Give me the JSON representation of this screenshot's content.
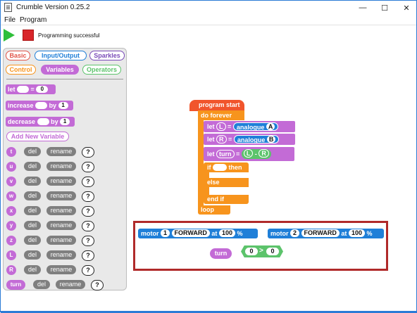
{
  "window": {
    "title": "Crumble Version 0.25.2",
    "minimize": "—",
    "maximize": "☐",
    "close": "✕"
  },
  "menu": {
    "file": "File",
    "program": "Program"
  },
  "toolbar": {
    "status": "Programming successful"
  },
  "palette": {
    "categories": [
      "Basic",
      "Input/Output",
      "Sparkles",
      "Control",
      "Variables",
      "Operators"
    ],
    "blocks": {
      "let": {
        "label": "let",
        "eq": "=",
        "value": "0"
      },
      "increase": {
        "label": "increase",
        "by": "by",
        "value": "1"
      },
      "decrease": {
        "label": "decrease",
        "by": "by",
        "value": "1"
      }
    },
    "add_variable": "Add New Variable",
    "del_label": "del",
    "rename_label": "rename",
    "value_label": "?",
    "variables": [
      "t",
      "u",
      "v",
      "w",
      "x",
      "y",
      "z",
      "L",
      "R",
      "turn"
    ]
  },
  "program": {
    "start": "program start",
    "do_forever": "do forever",
    "let": "let",
    "eq": "=",
    "var_L": "L",
    "var_R": "R",
    "var_turn": "turn",
    "analogue": "analogue",
    "pin_A": "A",
    "pin_B": "B",
    "minus": "-",
    "if": "if",
    "then": "then",
    "else": "else",
    "end_if": "end if",
    "loop": "loop"
  },
  "loose": {
    "motor1": {
      "label": "motor",
      "num": "1",
      "dir": "FORWARD",
      "at": "at",
      "speed": "100",
      "pct": "%"
    },
    "motor2": {
      "label": "motor",
      "num": "2",
      "dir": "FORWARD",
      "at": "at",
      "speed": "100",
      "pct": "%"
    },
    "turn": "turn",
    "compare": {
      "left": "0",
      "op": ">",
      "right": "0"
    }
  },
  "colors": {
    "control": "#f7941d",
    "variables": "#c36bd6",
    "motor": "#1f7fd8",
    "operators": "#5cc36b",
    "start": "#f1552c",
    "highlight": "#b02a2a"
  }
}
